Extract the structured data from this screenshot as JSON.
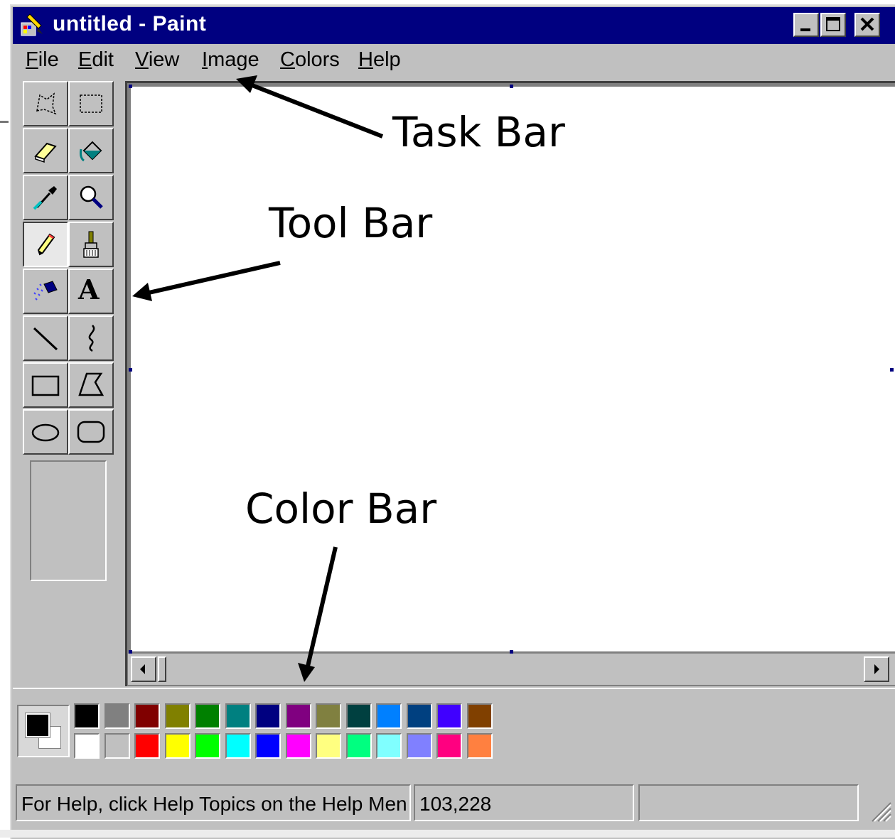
{
  "window": {
    "title": "untitled - Paint"
  },
  "menu": {
    "items": [
      {
        "key": "F",
        "rest": "ile"
      },
      {
        "key": "E",
        "rest": "dit"
      },
      {
        "key": "V",
        "rest": "iew"
      },
      {
        "key": "I",
        "rest": "mage"
      },
      {
        "key": "C",
        "rest": "olors"
      },
      {
        "key": "H",
        "rest": "elp"
      }
    ]
  },
  "tools": [
    "free-form-select-icon",
    "select-icon",
    "eraser-icon",
    "fill-icon",
    "pick-color-icon",
    "magnifier-icon",
    "pencil-icon",
    "brush-icon",
    "airbrush-icon",
    "text-icon",
    "line-icon",
    "curve-icon",
    "rectangle-icon",
    "polygon-icon",
    "ellipse-icon",
    "rounded-rectangle-icon"
  ],
  "text_tool_glyph": "A",
  "palette": {
    "foreground": "#000000",
    "background": "#ffffff",
    "top_row": [
      "#000000",
      "#808080",
      "#800000",
      "#808000",
      "#008000",
      "#008080",
      "#000080",
      "#800080",
      "#808040",
      "#004040",
      "#0080ff",
      "#004080",
      "#4000ff",
      "#804000"
    ],
    "bottom_row": [
      "#ffffff",
      "#c0c0c0",
      "#ff0000",
      "#ffff00",
      "#00ff00",
      "#00ffff",
      "#0000ff",
      "#ff00ff",
      "#ffff80",
      "#00ff80",
      "#80ffff",
      "#8080ff",
      "#ff0080",
      "#ff8040"
    ]
  },
  "status": {
    "help_text": "For Help, click Help Topics on the Help Men",
    "coordinates": "103,228",
    "size": ""
  },
  "annotations": {
    "task_bar": "Task Bar",
    "tool_bar": "Tool Bar",
    "color_bar": "Color Bar"
  }
}
